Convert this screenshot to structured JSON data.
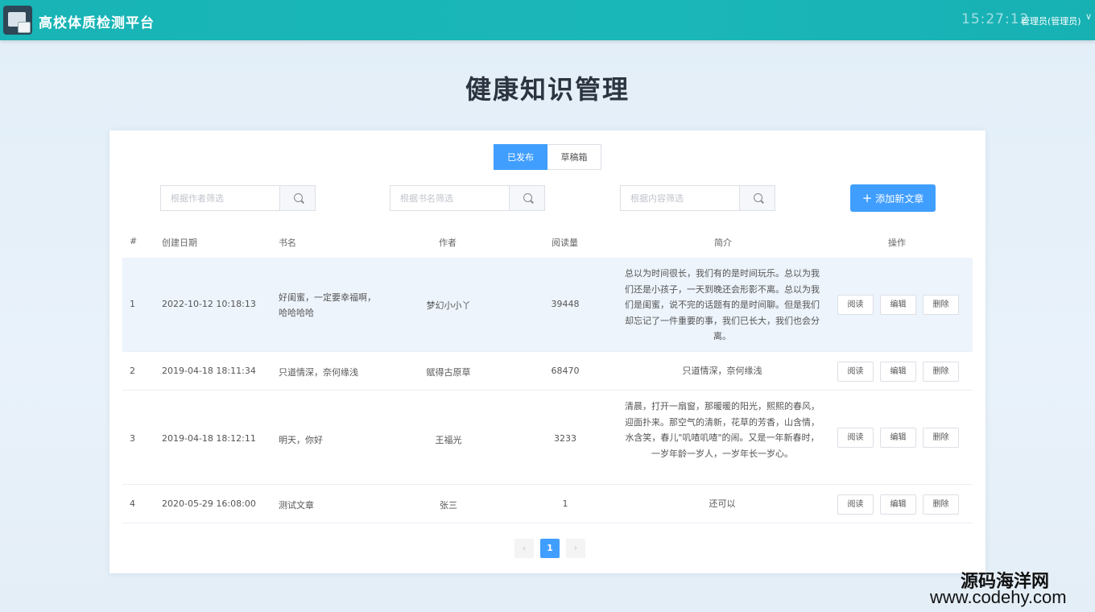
{
  "header": {
    "app_title": "高校体质检测平台",
    "clock": "15:27:12",
    "user": "管理员(管理员)"
  },
  "page": {
    "title": "健康知识管理"
  },
  "tabs": [
    {
      "label": "已发布",
      "active": true
    },
    {
      "label": "草稿箱",
      "active": false
    }
  ],
  "filters": {
    "author_placeholder": "根据作者筛选",
    "bookname_placeholder": "根据书名筛选",
    "content_placeholder": "根据内容筛选"
  },
  "add_button": "添加新文章",
  "columns": [
    "#",
    "创建日期",
    "书名",
    "作者",
    "阅读量",
    "简介",
    "操作"
  ],
  "rows": [
    {
      "idx": "1",
      "date": "2022-10-12 10:18:13",
      "title": "好闺蜜，一定要幸福啊，哈哈哈哈",
      "author": "梦幻小小丫",
      "reads": "39448",
      "summary": "总以为时间很长，我们有的是时间玩乐。总以为我们还是小孩子，一天到晚还会形影不离。总以为我们是闺蜜，说不完的话题有的是时间聊。但是我们却忘记了一件重要的事，我们已长大，我们也会分离。"
    },
    {
      "idx": "2",
      "date": "2019-04-18 18:11:34",
      "title": "只道情深，奈何缘浅",
      "author": "赋得古原草",
      "reads": "68470",
      "summary": "只道情深，奈何缘浅"
    },
    {
      "idx": "3",
      "date": "2019-04-18 18:12:11",
      "title": "明天，你好",
      "author": "王福光",
      "reads": "3233",
      "summary": "清晨，打开一扇窗，那暖暖的阳光，熙熙的春风，迎面扑来。那空气的清新，花草的芳香，山含情，水含笑，春儿\"叽喳叽喳\"的闹。又是一年新春时，一岁年龄一岁人，一岁年长一岁心。"
    },
    {
      "idx": "4",
      "date": "2020-05-29 16:08:00",
      "title": "测试文章",
      "author": "张三",
      "reads": "1",
      "summary": "还可以"
    }
  ],
  "actions": {
    "read": "阅读",
    "edit": "编辑",
    "delete": "删除"
  },
  "pager": {
    "prev": "‹",
    "current": "1",
    "next": "›"
  },
  "watermark": {
    "line1": "源码海洋网",
    "line2": "www.codehy.com"
  },
  "colors": {
    "header": "#18b4b6",
    "primary": "#409eff",
    "row_highlight": "#edf4fc"
  }
}
